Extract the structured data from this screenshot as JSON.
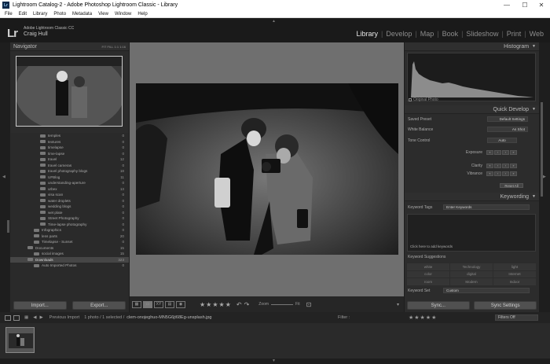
{
  "window": {
    "title": "Lightroom Catalog-2 - Adobe Photoshop Lightroom Classic - Library",
    "app_icon": "Lr",
    "min": "—",
    "max": "☐",
    "close": "✕"
  },
  "menu": [
    "File",
    "Edit",
    "Library",
    "Photo",
    "Metadata",
    "View",
    "Window",
    "Help"
  ],
  "identity": {
    "logo": "Lr",
    "product": "Adobe Lightroom Classic CC",
    "user": "Craig Hull"
  },
  "modules": [
    "Library",
    "Develop",
    "Map",
    "Book",
    "Slideshow",
    "Print",
    "Web"
  ],
  "module_sep": "|",
  "navigator": {
    "title": "Navigator",
    "options": [
      "FIT",
      "FILL",
      "1:1",
      "1:16"
    ]
  },
  "folders": [
    {
      "name": "temples",
      "count": "0"
    },
    {
      "name": "textures",
      "count": "0"
    },
    {
      "name": "timelapse",
      "count": "0"
    },
    {
      "name": "time-lapse",
      "count": "0"
    },
    {
      "name": "travel",
      "count": "12"
    },
    {
      "name": "travel cameras",
      "count": "0"
    },
    {
      "name": "travel photography blogs",
      "count": "18"
    },
    {
      "name": "UFBlog",
      "count": "11"
    },
    {
      "name": "understanding-aperture",
      "count": "0"
    },
    {
      "name": "urbex",
      "count": "13"
    },
    {
      "name": "visa scan",
      "count": "0"
    },
    {
      "name": "water droplets",
      "count": "0"
    },
    {
      "name": "wedding blogs",
      "count": "0"
    },
    {
      "name": "wet plate",
      "count": "0"
    },
    {
      "name": "Street Photography",
      "count": "0"
    },
    {
      "name": "Time-lapse photography",
      "count": "0"
    },
    {
      "name": "Infographics",
      "count": "0"
    },
    {
      "name": "lens parts",
      "count": "20"
    },
    {
      "name": "Timelapse - Sunset",
      "count": "0"
    },
    {
      "name": "Documents",
      "count": "15"
    },
    {
      "name": "social images",
      "count": "15"
    },
    {
      "name": "Downloads",
      "count": "323"
    },
    {
      "name": "Auto Imported Photos",
      "count": "0"
    }
  ],
  "left_buttons": {
    "import": "Import...",
    "export": "Export..."
  },
  "histogram": {
    "title": "Histogram",
    "original": "Original Photo"
  },
  "quick_develop": {
    "title": "Quick Develop",
    "saved_preset_label": "Saved Preset",
    "saved_preset_value": "Default Settings",
    "white_balance_label": "White Balance",
    "white_balance_value": "As Shot",
    "tone_control_label": "Tone Control",
    "auto": "Auto",
    "exposure": "Exposure",
    "clarity": "Clarity",
    "vibrance": "Vibrance",
    "reset": "Reset All"
  },
  "keywording": {
    "title": "Keywording",
    "tags_label": "Keyword Tags",
    "tags_value": "Enter Keywords",
    "hint": "Click here to add keywords",
    "suggestions_title": "Keyword Suggestions",
    "suggestions": [
      "white",
      "Technology",
      "light",
      "color",
      "digital",
      "Internet",
      "room",
      "Modern",
      "Indoor"
    ],
    "set_label": "Keyword Set",
    "set_value": "Custom"
  },
  "right_buttons": {
    "sync": "Sync...",
    "sync_settings": "Sync Settings"
  },
  "toolbar": {
    "zoom_label": "Zoom",
    "fit": "Fit"
  },
  "filmstrip": {
    "source": "Previous Import",
    "info": "1 photo / 1 selected /",
    "filename": "clem-onojeghuo-MN5G6jt68Eg-unsplash.jpg",
    "filter_label": "Filter :",
    "filters_off": "Filters Off"
  }
}
